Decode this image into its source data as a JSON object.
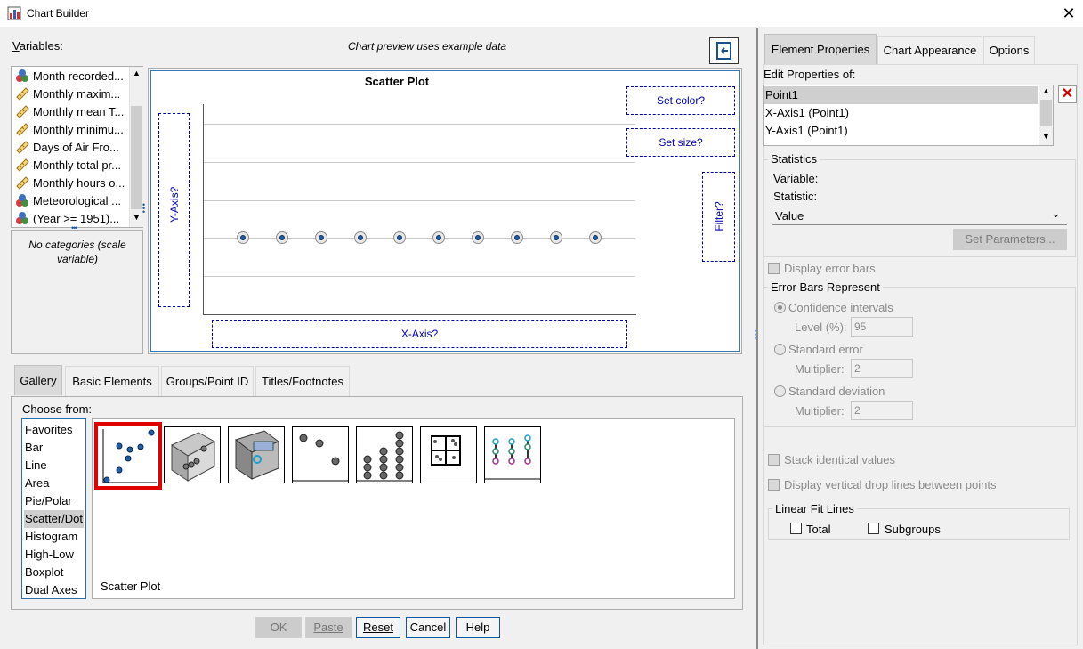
{
  "window": {
    "title": "Chart Builder"
  },
  "variables": {
    "label": "Variables:",
    "items": [
      {
        "label": "Month recorded...",
        "icon": "nominal-icon"
      },
      {
        "label": "Monthly maxim...",
        "icon": "scale-icon"
      },
      {
        "label": "Monthly mean T...",
        "icon": "scale-icon"
      },
      {
        "label": "Monthly minimu...",
        "icon": "scale-icon"
      },
      {
        "label": "Days of Air Fro...",
        "icon": "scale-icon"
      },
      {
        "label": "Monthly total pr...",
        "icon": "scale-icon"
      },
      {
        "label": "Monthly hours o...",
        "icon": "scale-icon"
      },
      {
        "label": "Meteorological ...",
        "icon": "nominal-icon"
      },
      {
        "label": "(Year >= 1951)...",
        "icon": "nominal-icon"
      }
    ],
    "categories_note": "No categories (scale variable)"
  },
  "preview": {
    "note": "Chart preview uses example data",
    "title": "Scatter Plot",
    "y_axis": "Y-Axis?",
    "x_axis": "X-Axis?",
    "set_color": "Set color?",
    "set_size": "Set size?",
    "filter": "Filter?",
    "points": 10
  },
  "bottom_tabs": [
    "Gallery",
    "Basic Elements",
    "Groups/Point ID",
    "Titles/Footnotes"
  ],
  "gallery": {
    "choose_from": "Choose from:",
    "items": [
      "Favorites",
      "Bar",
      "Line",
      "Area",
      "Pie/Polar",
      "Scatter/Dot",
      "Histogram",
      "High-Low",
      "Boxplot",
      "Dual Axes"
    ],
    "selected": "Scatter/Dot",
    "selected_chart_label": "Scatter Plot"
  },
  "buttons": {
    "ok": "OK",
    "paste": "Paste",
    "reset": "Reset",
    "cancel": "Cancel",
    "help": "Help"
  },
  "right_panel": {
    "tabs": [
      "Element Properties",
      "Chart Appearance",
      "Options"
    ],
    "edit_properties_label": "Edit Properties of:",
    "properties": [
      "Point1",
      "X-Axis1 (Point1)",
      "Y-Axis1 (Point1)"
    ],
    "statistics": {
      "title": "Statistics",
      "variable_label": "Variable:",
      "statistic_label": "Statistic:",
      "statistic_value": "Value",
      "set_parameters": "Set Parameters..."
    },
    "display_error_bars": "Display error bars",
    "error_bars": {
      "title": "Error Bars Represent",
      "confidence": "Confidence intervals",
      "level_label": "Level (%):",
      "level_value": "95",
      "std_error": "Standard error",
      "multiplier_label": "Multiplier:",
      "multiplier_value_1": "2",
      "std_dev": "Standard deviation",
      "multiplier_value_2": "2"
    },
    "stack_identical": "Stack identical values",
    "drop_lines": "Display vertical drop lines between points",
    "linear_fit": {
      "title": "Linear Fit Lines",
      "total": "Total",
      "subgroups": "Subgroups"
    }
  }
}
